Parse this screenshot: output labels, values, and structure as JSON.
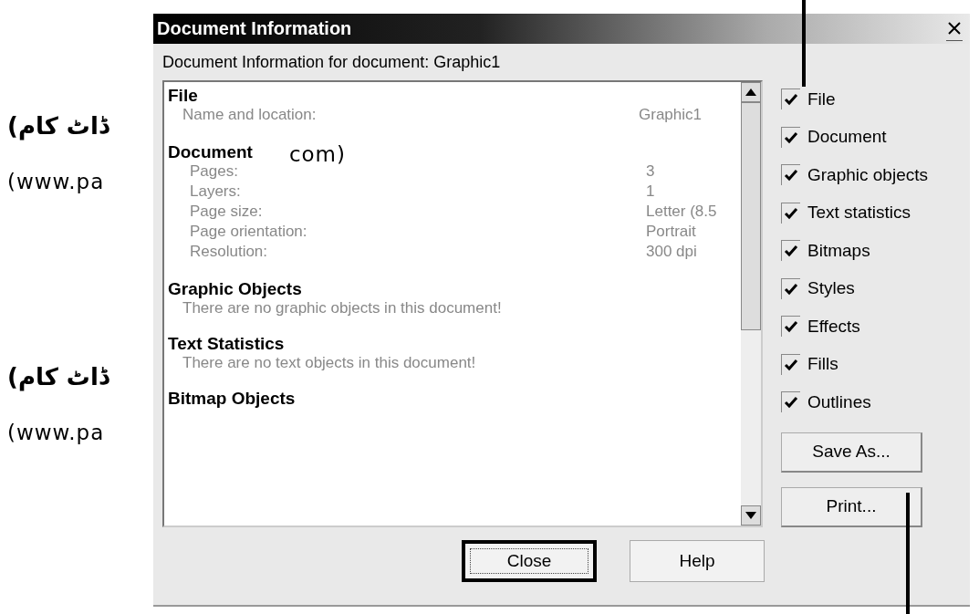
{
  "side_notes": [
    {
      "kind": "urdu",
      "text": "ڈاٹ کام)"
    },
    {
      "kind": "latin",
      "text": "(www.pa"
    },
    {
      "kind": "urdu",
      "text": "ڈاٹ کام)"
    },
    {
      "kind": "latin",
      "text": "(www.pa"
    }
  ],
  "window": {
    "title": "Document Information",
    "subtitle": "Document Information for document: Graphic1"
  },
  "info_list": {
    "sections": [
      {
        "heading": "File",
        "rows": [
          {
            "label": "Name and location:",
            "value": "Graphic1"
          }
        ]
      },
      {
        "heading": "Document",
        "overlay": "com)",
        "rows": [
          {
            "label": "Pages:",
            "value": "3"
          },
          {
            "label": "Layers:",
            "value": "1"
          },
          {
            "label": "Page size:",
            "value": "Letter (8.5"
          },
          {
            "label": "Page orientation:",
            "value": "Portrait"
          },
          {
            "label": "Resolution:",
            "value": "300 dpi"
          }
        ]
      },
      {
        "heading": "Graphic Objects",
        "message": "There are no graphic objects in this document!"
      },
      {
        "heading": "Text Statistics",
        "message": "There are no text objects in this document!"
      },
      {
        "heading": "Bitmap Objects"
      }
    ]
  },
  "options": [
    {
      "label": "File",
      "checked": true
    },
    {
      "label": "Document",
      "checked": true
    },
    {
      "label": "Graphic objects",
      "checked": true
    },
    {
      "label": "Text statistics",
      "checked": true
    },
    {
      "label": "Bitmaps",
      "checked": true
    },
    {
      "label": "Styles",
      "checked": true
    },
    {
      "label": "Effects",
      "checked": true
    },
    {
      "label": "Fills",
      "checked": true
    },
    {
      "label": "Outlines",
      "checked": true
    }
  ],
  "side_buttons": [
    "Save As...",
    "Print..."
  ],
  "buttons": [
    {
      "label": "Close",
      "selected": true
    },
    {
      "label": "Help",
      "selected": false
    }
  ]
}
